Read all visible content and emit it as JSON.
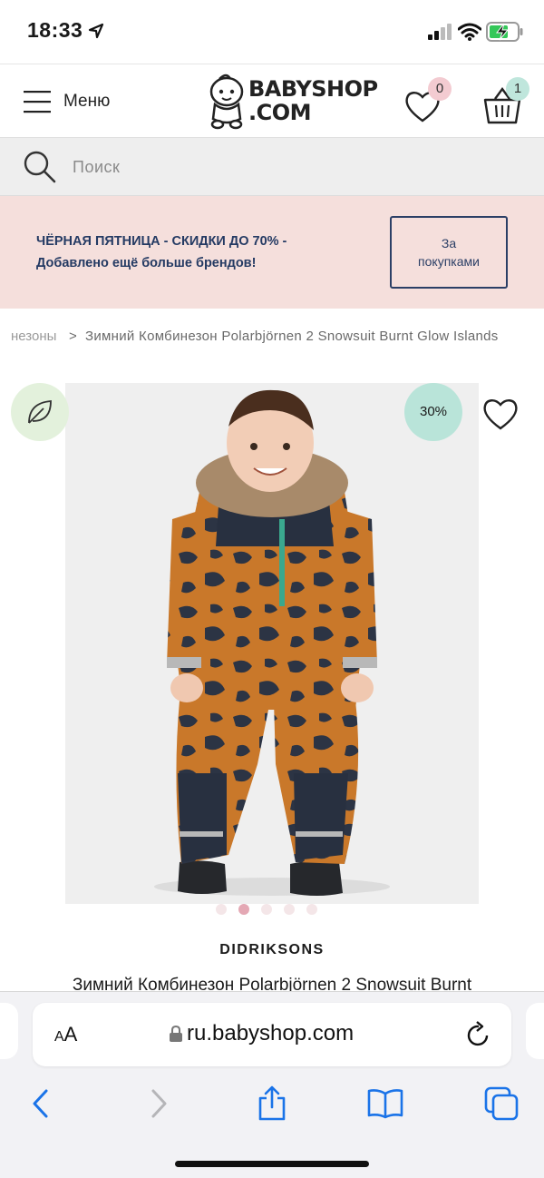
{
  "status_bar": {
    "time": "18:33"
  },
  "header": {
    "menu_label": "Меню",
    "logo_line1": "BABYSHOP",
    "logo_line2": ".COM",
    "wishlist_count": "0",
    "cart_count": "1"
  },
  "search": {
    "placeholder": "Поиск"
  },
  "promo": {
    "line1": "ЧЁРНАЯ ПЯТНИЦА - СКИДКИ ДО 70% -",
    "line2": "Добавлено ещё больше брендов!",
    "button_line1": "За",
    "button_line2": "покупками"
  },
  "breadcrumb": {
    "previous": "незоны",
    "separator": ">",
    "current": "Зимний Комбинезон Polarbjörnen 2 Snowsuit Burnt Glow Islands"
  },
  "product": {
    "discount": "30%",
    "eco_icon": "leaf-icon",
    "gallery_total": 5,
    "gallery_active": 2,
    "brand": "DIDRIKSONS",
    "title": "Зимний Комбинезон Polarbjörnen 2 Snowsuit Burnt"
  },
  "browser": {
    "aa_label_small": "A",
    "aa_label_large": "A",
    "url": "ru.babyshop.com"
  },
  "colors": {
    "promo_bg": "#f5dfdc",
    "promo_text": "#243a63",
    "badge_pink": "#f3cbd1",
    "badge_mint": "#bfe6dc",
    "discount_bg": "#b9e4d9",
    "eco_bg": "#e3f1dc",
    "safari_blue": "#1a73e8"
  }
}
